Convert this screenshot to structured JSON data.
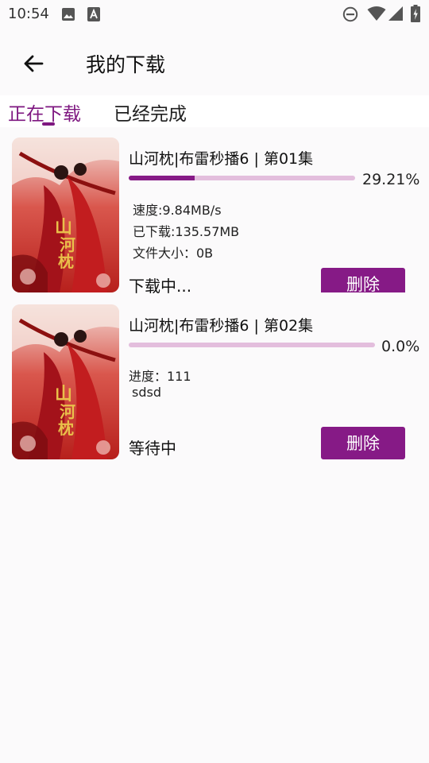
{
  "status_bar": {
    "time": "10:54"
  },
  "header": {
    "title": "我的下载"
  },
  "tabs": [
    {
      "label": "正在下载"
    },
    {
      "label": "已经完成"
    }
  ],
  "colors": {
    "accent": "#861a86",
    "track": "#e3bedd"
  },
  "downloads": [
    {
      "name": "山河枕|布雷秒播6 | 第01集",
      "progress_text": "29.21%",
      "progress_fraction": 0.2921,
      "speed": "速度:9.84MB/s",
      "downloaded": "已下载:135.57MB",
      "file_size": "文件大小：0B",
      "status": "下载中...",
      "delete_label": "删除"
    },
    {
      "name": "山河枕|布雷秒播6 | 第02集",
      "progress_text": "0.0%",
      "progress_fraction": 0.0,
      "progress_info": "进度：111",
      "extra": "sdsd",
      "status": "等待中",
      "delete_label": "删除"
    }
  ]
}
